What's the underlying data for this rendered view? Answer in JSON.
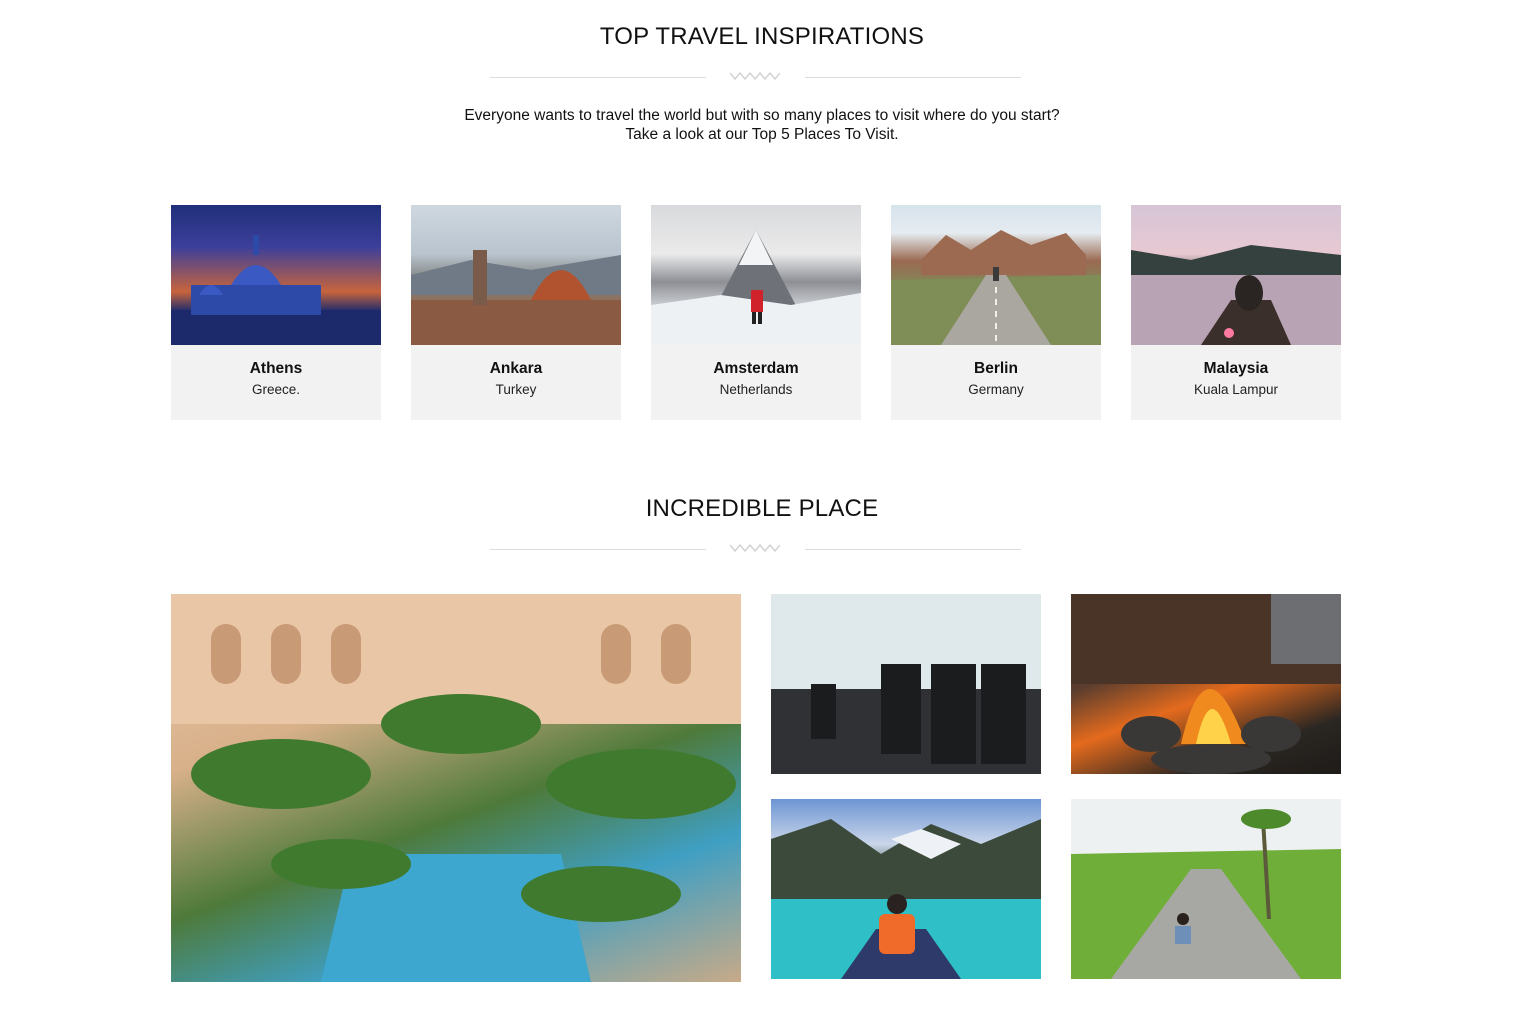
{
  "section1": {
    "title": "TOP TRAVEL INSPIRATIONS",
    "intro_line1": "Everyone wants to travel the world but with so many places to visit where do you start?",
    "intro_line2": "Take a look at our Top 5 Places To Visit."
  },
  "destinations": [
    {
      "name": "Athens",
      "country": "Greece."
    },
    {
      "name": "Ankara",
      "country": "Turkey"
    },
    {
      "name": "Amsterdam",
      "country": "Netherlands"
    },
    {
      "name": "Berlin",
      "country": "Germany"
    },
    {
      "name": "Malaysia",
      "country": "Kuala Lampur"
    }
  ],
  "section2": {
    "title": "INCREDIBLE PLACE"
  }
}
